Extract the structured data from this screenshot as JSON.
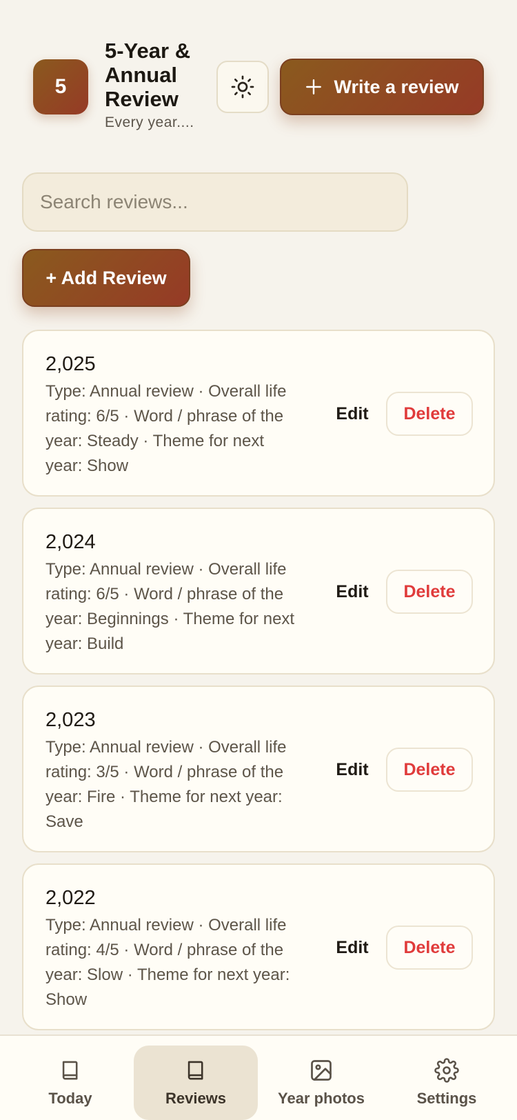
{
  "header": {
    "logo_text": "5",
    "title": "5-Year & Annual Review",
    "subtitle": "Every year....",
    "theme_icon": "sun-icon",
    "write_button": {
      "icon": "plus-icon",
      "label": "Write a review"
    }
  },
  "search": {
    "placeholder": "Search reviews..."
  },
  "add_button": {
    "label": "+ Add Review"
  },
  "reviews": [
    {
      "year": "2,025",
      "description": "Type: Annual review · Overall life rating: 6/5 · Word / phrase of the year: Steady · Theme for next year: Show",
      "edit_label": "Edit",
      "delete_label": "Delete"
    },
    {
      "year": "2,024",
      "description": "Type: Annual review · Overall life rating: 6/5 · Word / phrase of the year: Beginnings · Theme for next year: Build",
      "edit_label": "Edit",
      "delete_label": "Delete"
    },
    {
      "year": "2,023",
      "description": "Type: Annual review · Overall life rating: 3/5 · Word / phrase of the year: Fire · Theme for next year: Save",
      "edit_label": "Edit",
      "delete_label": "Delete"
    },
    {
      "year": "2,022",
      "description": "Type: Annual review · Overall life rating: 4/5 · Word / phrase of the year: Slow · Theme for next year: Show",
      "edit_label": "Edit",
      "delete_label": "Delete"
    }
  ],
  "nav": [
    {
      "label": "Today",
      "icon": "book-icon",
      "active": false
    },
    {
      "label": "Reviews",
      "icon": "book-icon",
      "active": true
    },
    {
      "label": "Year photos",
      "icon": "image-icon",
      "active": false
    },
    {
      "label": "Settings",
      "icon": "gear-icon",
      "active": false
    }
  ],
  "colors": {
    "accent_start": "#8a5a1e",
    "accent_end": "#963a26",
    "danger": "#e03b3b",
    "background": "#f6f3ec",
    "card": "#fffdf6"
  }
}
